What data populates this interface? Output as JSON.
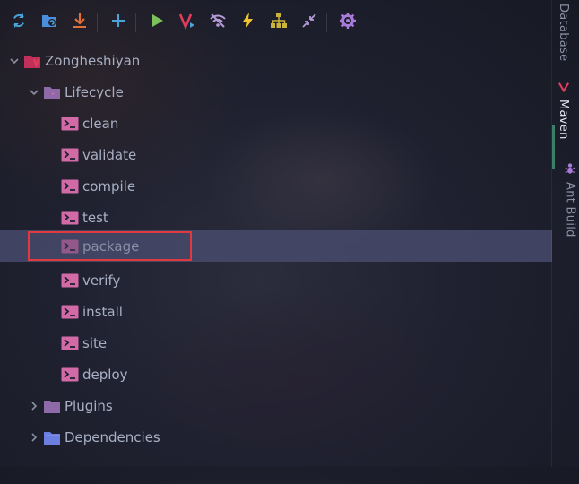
{
  "toolbar": {
    "buttons": [
      {
        "name": "reload-icon",
        "color": "#4aa3d9"
      },
      {
        "name": "generate-sources-icon",
        "color": "#4a8fdd"
      },
      {
        "name": "download-icon",
        "color": "#e0703a"
      },
      {
        "name": "add-icon",
        "color": "#4aa3d9"
      },
      {
        "name": "run-icon",
        "color": "#7bc25a"
      },
      {
        "name": "maven-goal-icon",
        "color": "#e23d5c"
      },
      {
        "name": "toggle-offline-icon",
        "color": "#b59ad6"
      },
      {
        "name": "skip-tests-icon",
        "color": "#f0c330"
      },
      {
        "name": "dependencies-diagram-icon",
        "color": "#c9b33a"
      },
      {
        "name": "collapse-all-icon",
        "color": "#b59ad6"
      },
      {
        "name": "settings-icon",
        "color": "#a97bd9"
      }
    ]
  },
  "tree": {
    "project": {
      "label": "Zongheshiyan",
      "expanded": true
    },
    "lifecycle": {
      "label": "Lifecycle",
      "expanded": true,
      "goals": [
        {
          "label": "clean"
        },
        {
          "label": "validate"
        },
        {
          "label": "compile"
        },
        {
          "label": "test"
        },
        {
          "label": "package",
          "selected": true
        },
        {
          "label": "verify"
        },
        {
          "label": "install"
        },
        {
          "label": "site"
        },
        {
          "label": "deploy"
        }
      ]
    },
    "plugins": {
      "label": "Plugins",
      "expanded": false
    },
    "dependencies": {
      "label": "Dependencies",
      "expanded": false
    }
  },
  "sidebar": {
    "tabs": [
      {
        "label": "Database",
        "active": false
      },
      {
        "label": "Maven",
        "active": true
      },
      {
        "label": "Ant Build",
        "active": false
      }
    ]
  },
  "colors": {
    "selection": "#484a6c",
    "highlight_border": "#e0393e",
    "goal_icon": "#d36aa8",
    "plugins_folder": "#8e6aa8",
    "dependencies_folder": "#6c7fe0"
  }
}
